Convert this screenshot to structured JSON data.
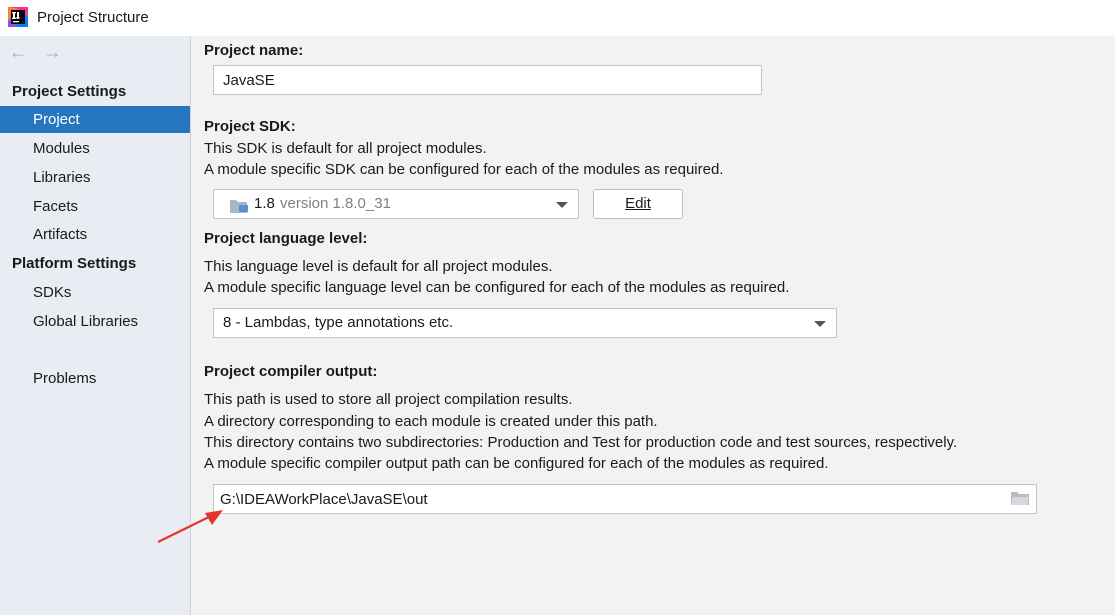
{
  "window": {
    "title": "Project Structure",
    "app_icon": "intellij-idea-icon"
  },
  "sidebar": {
    "back_icon": "←",
    "forward_icon": "→",
    "project_settings_heading": "Project Settings",
    "project_items": [
      {
        "label": "Project",
        "selected": true
      },
      {
        "label": "Modules",
        "selected": false
      },
      {
        "label": "Libraries",
        "selected": false
      },
      {
        "label": "Facets",
        "selected": false
      },
      {
        "label": "Artifacts",
        "selected": false
      }
    ],
    "platform_settings_heading": "Platform Settings",
    "platform_items": [
      {
        "label": "SDKs"
      },
      {
        "label": "Global Libraries"
      }
    ],
    "problems_label": "Problems"
  },
  "main": {
    "project_name": {
      "label": "Project name:",
      "value": "JavaSE"
    },
    "project_sdk": {
      "label": "Project SDK:",
      "desc_line1": "This SDK is default for all project modules.",
      "desc_line2": "A module specific SDK can be configured for each of the modules as required.",
      "selected_name": "1.8",
      "selected_version": "version 1.8.0_31",
      "edit_label": "Edit"
    },
    "language_level": {
      "label": "Project language level:",
      "desc_line1": "This language level is default for all project modules.",
      "desc_line2": "A module specific language level can be configured for each of the modules as required.",
      "selected": "8 - Lambdas, type annotations etc."
    },
    "compiler_output": {
      "label": "Project compiler output:",
      "desc_line1": "This path is used to store all project compilation results.",
      "desc_line2": "A directory corresponding to each module is created under this path.",
      "desc_line3": "This directory contains two subdirectories: Production and Test for production code and test sources, respectively.",
      "desc_line4": "A module specific compiler output path can be configured for each of the modules as required.",
      "path": "G:\\IDEAWorkPlace\\JavaSE\\out"
    }
  },
  "colors": {
    "selection": "#2675bf",
    "annotation_arrow": "#e8342a",
    "sidebar_bg": "#e9edf3",
    "content_bg": "#f2f2f2"
  }
}
